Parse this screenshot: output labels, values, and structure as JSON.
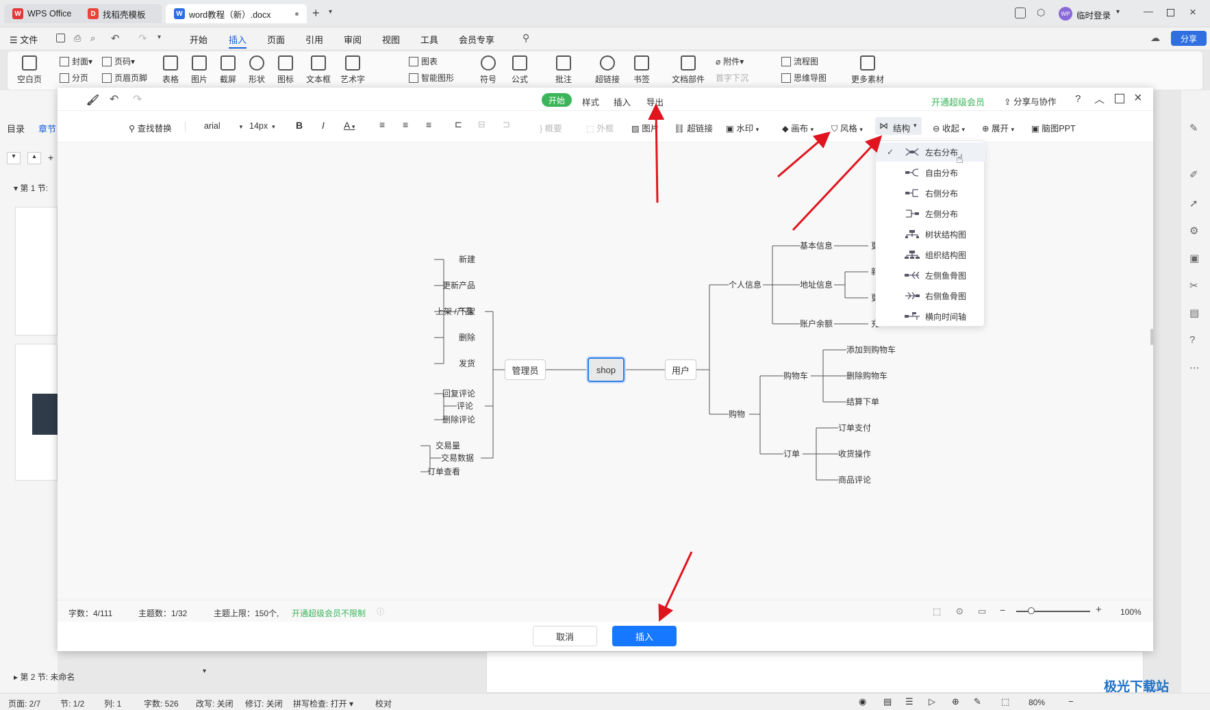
{
  "titlebar": {
    "tabs": [
      {
        "label": "WPS Office"
      },
      {
        "label": "找稻壳模板"
      },
      {
        "label": "word教程（新）.docx"
      }
    ],
    "user": "临时登录"
  },
  "menubar": {
    "file": "文件",
    "items": [
      "开始",
      "插入",
      "页面",
      "引用",
      "审阅",
      "视图",
      "工具",
      "会员专享"
    ],
    "active": "插入",
    "share": "分享"
  },
  "ribbon": {
    "items": [
      "空白页",
      "封面",
      "分页",
      "页码",
      "页眉页脚",
      "表格",
      "图片",
      "截屏",
      "形状",
      "图标",
      "文本框",
      "艺术字",
      "图表",
      "智能图形",
      "符号",
      "公式",
      "批注",
      "超链接",
      "书签",
      "文档部件",
      "附件",
      "首字下沉",
      "流程图",
      "思维导图",
      "更多素材"
    ]
  },
  "leftpanel": {
    "tabs": [
      "目录",
      "章节"
    ],
    "section1": "第 1 节:",
    "section2": "第 2 节: 未命名"
  },
  "modal": {
    "tabs": [
      "开始",
      "样式",
      "插入",
      "导出"
    ],
    "active_tab": "开始",
    "vip_link": "开通超级会员",
    "share": "分享与协作",
    "toolbar": {
      "find": "查找替换",
      "font": "arial",
      "size": "14px",
      "summary": "概要",
      "frame": "外框",
      "image": "图片",
      "link": "超链接",
      "watermark": "水印",
      "canvas": "画布",
      "style": "风格",
      "structure": "结构",
      "collapse": "收起",
      "expand": "展开",
      "ppt": "脑图PPT"
    },
    "dropdown": [
      {
        "label": "左右分布",
        "checked": true
      },
      {
        "label": "自由分布",
        "checked": false
      },
      {
        "label": "右侧分布",
        "checked": false
      },
      {
        "label": "左侧分布",
        "checked": false
      },
      {
        "label": "树状结构图",
        "checked": false
      },
      {
        "label": "组织结构图",
        "checked": false
      },
      {
        "label": "左侧鱼骨图",
        "checked": false
      },
      {
        "label": "右侧鱼骨图",
        "checked": false
      },
      {
        "label": "横向时间轴",
        "checked": false
      }
    ],
    "mindmap": {
      "root": "shop",
      "left_branch": "管理员",
      "right_branch": "用户",
      "left": [
        {
          "label": "产品",
          "children": [
            "新建",
            "更新产品",
            "上架 / 下架",
            "删除",
            "发货"
          ]
        },
        {
          "label": "评论",
          "children": [
            "回复评论",
            "删除评论"
          ]
        },
        {
          "label": "交易数据",
          "children": [
            "交易量",
            "订单查看"
          ]
        }
      ],
      "right": [
        {
          "label": "个人信息",
          "children": [
            {
              "label": "基本信息",
              "partial": "更"
            },
            {
              "label": "地址信息",
              "partial": [
                "新",
                "更"
              ]
            },
            {
              "label": "账户余额",
              "partial": "充"
            }
          ]
        },
        {
          "label": "购物",
          "children": [
            {
              "label": "购物车",
              "children": [
                "添加到购物车",
                "删除购物车",
                "结算下单"
              ]
            },
            {
              "label": "订单",
              "children": [
                "订单支付",
                "收货操作",
                "商品评论"
              ]
            }
          ]
        }
      ]
    },
    "status": {
      "words": "字数：4/111",
      "topics": "主题数：1/32",
      "limit": "主题上限：150个,",
      "vip": "开通超级会员不限制",
      "zoom": "100%",
      "zoom_level": 0.2
    },
    "cancel": "取消",
    "insert": "插入"
  },
  "statusbar": {
    "page": "页面: 2/7",
    "section": "节: 1/2",
    "col": "列: 1",
    "words": "字数: 526",
    "edit": "改写: 关闭",
    "revise": "修订: 关闭",
    "spell": "拼写检查: 打开",
    "proof": "校对",
    "zoom": "80%"
  },
  "watermark_text": "极光下载站",
  "colors": {
    "accent_green": "#3bb55a",
    "insert_blue": "#1677ff",
    "arrow_red": "#e0141e",
    "node_border_blue": "#2b7de9"
  }
}
